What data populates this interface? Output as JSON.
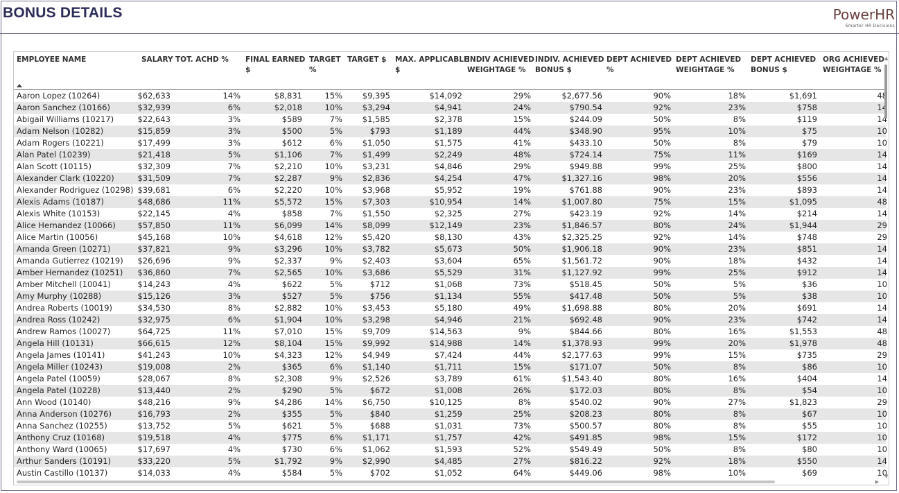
{
  "page": {
    "title": "BONUS DETAILS"
  },
  "logo": {
    "name": "PowerHR",
    "tagline": "Smarter HR Decisions"
  },
  "table": {
    "columns": [
      {
        "key": "name",
        "l1": "EMPLOYEE NAME",
        "l2": ""
      },
      {
        "key": "salary",
        "l1": "SALARY",
        "l2": ""
      },
      {
        "key": "tot_achd",
        "l1": "TOT. ACHD %",
        "l2": ""
      },
      {
        "key": "final_earned",
        "l1": "FINAL EARNED",
        "l2": "$"
      },
      {
        "key": "target_pct",
        "l1": "TARGET",
        "l2": "%"
      },
      {
        "key": "target_usd",
        "l1": "TARGET $",
        "l2": ""
      },
      {
        "key": "max_applicable",
        "l1": "MAX. APPLICABLE",
        "l2": "$"
      },
      {
        "key": "indiv_weightage",
        "l1": "INDIV ACHIEVED",
        "l2": "WEIGHTAGE %"
      },
      {
        "key": "indiv_bonus",
        "l1": "INDIV. ACHIEVED",
        "l2": "BONUS $"
      },
      {
        "key": "dept_achieved",
        "l1": "DEPT ACHIEVED",
        "l2": "%"
      },
      {
        "key": "dept_weightage",
        "l1": "DEPT ACHIEVED",
        "l2": "WEIGHTAGE %"
      },
      {
        "key": "dept_bonus",
        "l1": "DEPT ACHIEVED",
        "l2": "BONUS $"
      },
      {
        "key": "org_weightage",
        "l1": "ORG ACHIEVED",
        "l2": "WEIGHTAGE %"
      }
    ],
    "rows": [
      [
        "Aaron Lopez (10264)",
        "$62,633",
        "14%",
        "$8,831",
        "15%",
        "$9,395",
        "$14,092",
        "29%",
        "$2,677.56",
        "90%",
        "18%",
        "$1,691",
        "48"
      ],
      [
        "Aaron Sanchez (10166)",
        "$32,939",
        "6%",
        "$2,018",
        "10%",
        "$3,294",
        "$4,941",
        "24%",
        "$790.54",
        "92%",
        "23%",
        "$758",
        "14"
      ],
      [
        "Abigail Williams (10217)",
        "$22,643",
        "3%",
        "$589",
        "7%",
        "$1,585",
        "$2,378",
        "15%",
        "$244.09",
        "50%",
        "8%",
        "$119",
        "14"
      ],
      [
        "Adam Nelson (10282)",
        "$15,859",
        "3%",
        "$500",
        "5%",
        "$793",
        "$1,189",
        "44%",
        "$348.90",
        "95%",
        "10%",
        "$75",
        "10"
      ],
      [
        "Adam Rogers (10221)",
        "$17,499",
        "3%",
        "$612",
        "6%",
        "$1,050",
        "$1,575",
        "41%",
        "$433.10",
        "50%",
        "8%",
        "$79",
        "10"
      ],
      [
        "Alan Patel (10239)",
        "$21,418",
        "5%",
        "$1,106",
        "7%",
        "$1,499",
        "$2,249",
        "48%",
        "$724.14",
        "75%",
        "11%",
        "$169",
        "14"
      ],
      [
        "Alan Scott (10115)",
        "$32,309",
        "7%",
        "$2,210",
        "10%",
        "$3,231",
        "$4,846",
        "29%",
        "$949.88",
        "99%",
        "25%",
        "$800",
        "14"
      ],
      [
        "Alexander Clark (10220)",
        "$31,509",
        "7%",
        "$2,287",
        "9%",
        "$2,836",
        "$4,254",
        "47%",
        "$1,327.16",
        "98%",
        "20%",
        "$556",
        "14"
      ],
      [
        "Alexander Rodriguez (10298)",
        "$39,681",
        "6%",
        "$2,220",
        "10%",
        "$3,968",
        "$5,952",
        "19%",
        "$761.88",
        "90%",
        "23%",
        "$893",
        "14"
      ],
      [
        "Alexis Adams (10187)",
        "$48,686",
        "11%",
        "$5,572",
        "15%",
        "$7,303",
        "$10,954",
        "14%",
        "$1,007.80",
        "75%",
        "15%",
        "$1,095",
        "48"
      ],
      [
        "Alexis White (10153)",
        "$22,145",
        "4%",
        "$858",
        "7%",
        "$1,550",
        "$2,325",
        "27%",
        "$423.19",
        "92%",
        "14%",
        "$214",
        "14"
      ],
      [
        "Alice Hernandez (10066)",
        "$57,850",
        "11%",
        "$6,099",
        "14%",
        "$8,099",
        "$12,149",
        "23%",
        "$1,846.57",
        "80%",
        "24%",
        "$1,944",
        "29"
      ],
      [
        "Alice Martin (10056)",
        "$45,168",
        "10%",
        "$4,618",
        "12%",
        "$5,420",
        "$8,130",
        "43%",
        "$2,325.25",
        "92%",
        "14%",
        "$748",
        "29"
      ],
      [
        "Amanda Green (10271)",
        "$37,821",
        "9%",
        "$3,296",
        "10%",
        "$3,782",
        "$5,673",
        "50%",
        "$1,906.18",
        "90%",
        "23%",
        "$851",
        "14"
      ],
      [
        "Amanda Gutierrez (10219)",
        "$26,696",
        "9%",
        "$2,337",
        "9%",
        "$2,403",
        "$3,604",
        "65%",
        "$1,561.72",
        "90%",
        "18%",
        "$432",
        "14"
      ],
      [
        "Amber Hernandez (10251)",
        "$36,860",
        "7%",
        "$2,565",
        "10%",
        "$3,686",
        "$5,529",
        "31%",
        "$1,127.92",
        "99%",
        "25%",
        "$912",
        "14"
      ],
      [
        "Amber Mitchell (10041)",
        "$14,243",
        "4%",
        "$622",
        "5%",
        "$712",
        "$1,068",
        "73%",
        "$518.45",
        "50%",
        "5%",
        "$36",
        "10"
      ],
      [
        "Amy Murphy (10288)",
        "$15,126",
        "3%",
        "$527",
        "5%",
        "$756",
        "$1,134",
        "55%",
        "$417.48",
        "50%",
        "5%",
        "$38",
        "10"
      ],
      [
        "Andrea Roberts (10019)",
        "$34,530",
        "8%",
        "$2,882",
        "10%",
        "$3,453",
        "$5,180",
        "49%",
        "$1,698.88",
        "80%",
        "20%",
        "$691",
        "14"
      ],
      [
        "Andrea Ross (10242)",
        "$32,975",
        "6%",
        "$1,904",
        "10%",
        "$3,298",
        "$4,946",
        "21%",
        "$692.48",
        "90%",
        "23%",
        "$742",
        "14"
      ],
      [
        "Andrew Ramos (10027)",
        "$64,725",
        "11%",
        "$7,010",
        "15%",
        "$9,709",
        "$14,563",
        "9%",
        "$844.66",
        "80%",
        "16%",
        "$1,553",
        "48"
      ],
      [
        "Angela Hill (10131)",
        "$66,615",
        "12%",
        "$8,104",
        "15%",
        "$9,992",
        "$14,988",
        "14%",
        "$1,378.93",
        "99%",
        "20%",
        "$1,978",
        "48"
      ],
      [
        "Angela James (10141)",
        "$41,243",
        "10%",
        "$4,323",
        "12%",
        "$4,949",
        "$7,424",
        "44%",
        "$2,177.63",
        "99%",
        "15%",
        "$735",
        "29"
      ],
      [
        "Angela Miller (10243)",
        "$19,008",
        "2%",
        "$365",
        "6%",
        "$1,140",
        "$1,711",
        "15%",
        "$171.07",
        "50%",
        "8%",
        "$86",
        "10"
      ],
      [
        "Angela Patel (10059)",
        "$28,067",
        "8%",
        "$2,308",
        "9%",
        "$2,526",
        "$3,789",
        "61%",
        "$1,543.40",
        "80%",
        "16%",
        "$404",
        "14"
      ],
      [
        "Angela Patel (10228)",
        "$13,440",
        "2%",
        "$290",
        "5%",
        "$672",
        "$1,008",
        "26%",
        "$172.03",
        "80%",
        "8%",
        "$54",
        "10"
      ],
      [
        "Ann Wood (10140)",
        "$48,216",
        "9%",
        "$4,286",
        "14%",
        "$6,750",
        "$10,125",
        "8%",
        "$540.02",
        "90%",
        "27%",
        "$1,823",
        "29"
      ],
      [
        "Anna Anderson (10276)",
        "$16,793",
        "2%",
        "$355",
        "5%",
        "$840",
        "$1,259",
        "25%",
        "$208.23",
        "80%",
        "8%",
        "$67",
        "10"
      ],
      [
        "Anna Sanchez (10255)",
        "$13,752",
        "5%",
        "$621",
        "5%",
        "$688",
        "$1,031",
        "73%",
        "$500.57",
        "80%",
        "8%",
        "$55",
        "10"
      ],
      [
        "Anthony Cruz (10168)",
        "$19,518",
        "4%",
        "$775",
        "6%",
        "$1,171",
        "$1,757",
        "42%",
        "$491.85",
        "98%",
        "15%",
        "$172",
        "10"
      ],
      [
        "Anthony Ward (10065)",
        "$17,697",
        "4%",
        "$730",
        "6%",
        "$1,062",
        "$1,593",
        "52%",
        "$549.49",
        "50%",
        "8%",
        "$80",
        "10"
      ],
      [
        "Arthur Sanders (10191)",
        "$33,220",
        "5%",
        "$1,792",
        "9%",
        "$2,990",
        "$4,485",
        "27%",
        "$816.22",
        "92%",
        "18%",
        "$550",
        "14"
      ],
      [
        "Austin Castillo (10137)",
        "$14,033",
        "4%",
        "$584",
        "5%",
        "$702",
        "$1,052",
        "64%",
        "$449.06",
        "98%",
        "10%",
        "$69",
        "10"
      ]
    ]
  }
}
